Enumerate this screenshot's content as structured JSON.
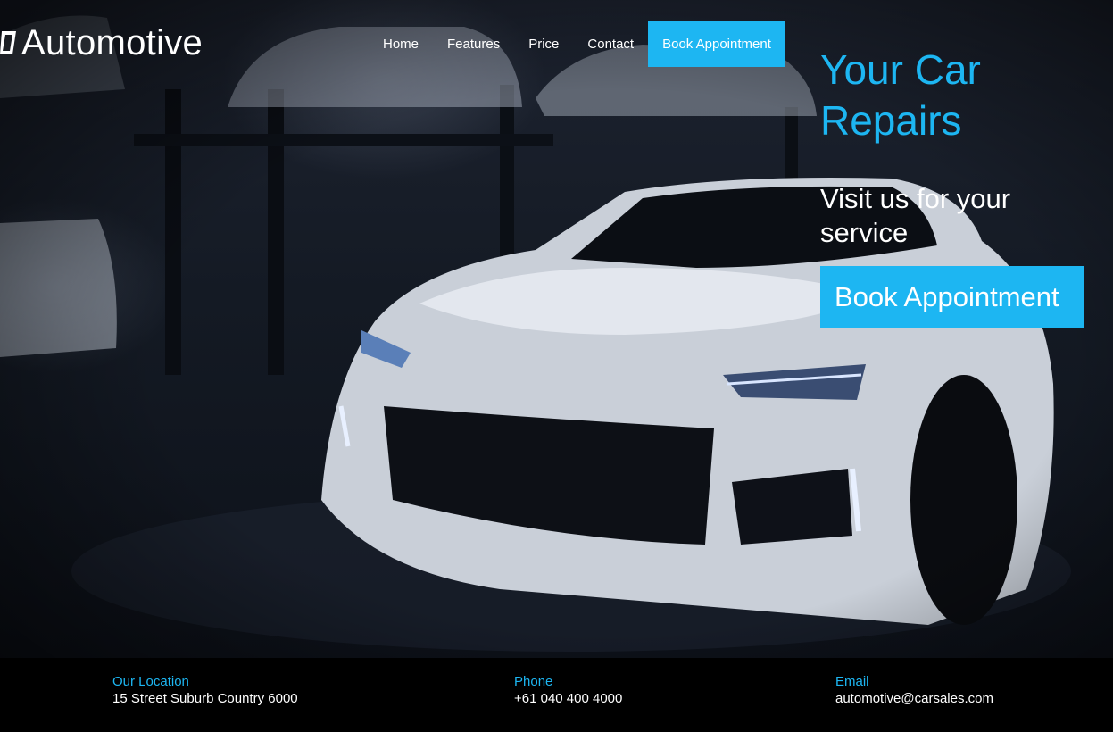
{
  "brand": {
    "logo_text": "Automotive",
    "accent": "#1db6f2"
  },
  "nav": {
    "items": [
      {
        "label": "Home"
      },
      {
        "label": "Features"
      },
      {
        "label": "Price"
      },
      {
        "label": "Contact"
      }
    ],
    "cta_label": "Book Appointment"
  },
  "hero": {
    "title": "Your Car Repairs",
    "subtitle": "Visit us for your service",
    "button_label": "Book Appointment"
  },
  "footer": {
    "location": {
      "label": "Our Location",
      "value": "15 Street Suburb Country 6000"
    },
    "phone": {
      "label": "Phone",
      "value": "+61 040 400 4000"
    },
    "email": {
      "label": "Email",
      "value": "automotive@carsales.com"
    }
  }
}
